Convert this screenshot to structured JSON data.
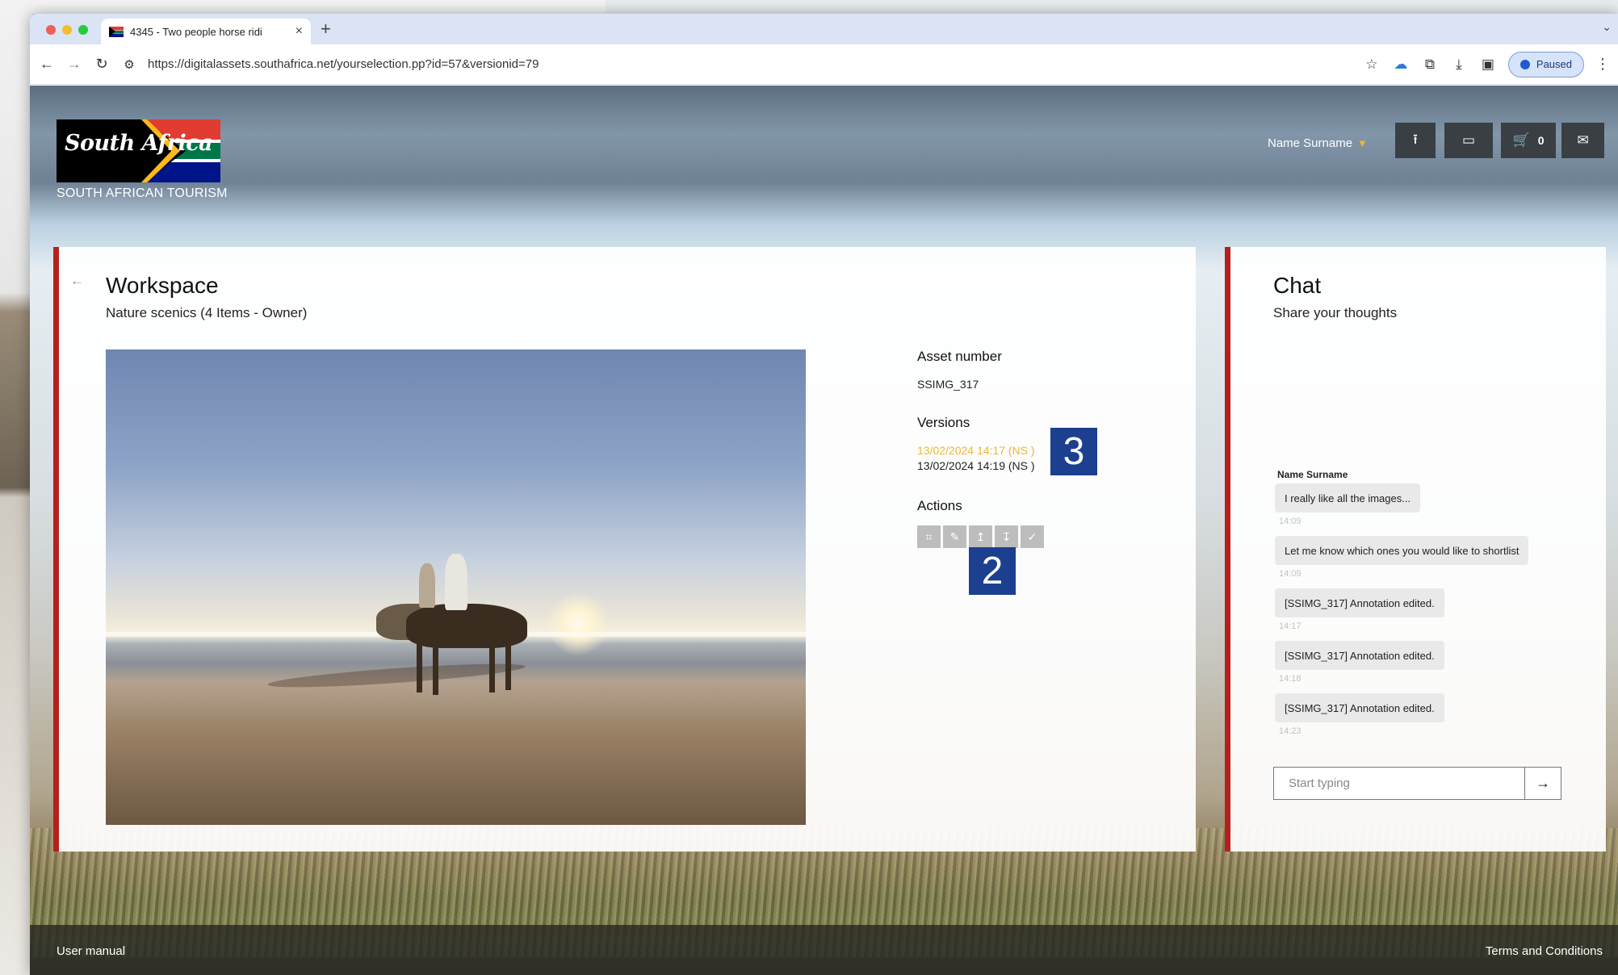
{
  "browser": {
    "tab_title": "4345 - Two people horse ridi",
    "tab_close": "×",
    "new_tab": "+",
    "url": "https://digitalassets.southafrica.net/yourselection.pp?id=57&versionid=79",
    "profile_label": "Paused",
    "icons": [
      "back-icon",
      "forward-icon",
      "reload-icon",
      "site-info-icon",
      "star-icon",
      "download-cloud-icon",
      "extensions-icon",
      "download-icon",
      "sidepanel-icon",
      "profile-icon",
      "menu-icon"
    ]
  },
  "header": {
    "logo_text": "South Africa",
    "brand_name": "SOUTH AFRICAN TOURISM",
    "user_name": "Name Surname",
    "cart_count": "0",
    "icons": [
      "upload-icon",
      "screen-icon",
      "cart-icon",
      "mail-icon"
    ]
  },
  "workspace": {
    "title": "Workspace",
    "subtitle": "Nature scenics (4 Items - Owner)",
    "asset_number_label": "Asset number",
    "asset_number": "SSIMG_317",
    "versions_label": "Versions",
    "versions": [
      {
        "text": "13/02/2024 14:17 (NS )",
        "active": true
      },
      {
        "text": "13/02/2024 14:19 (NS )",
        "active": false
      }
    ],
    "actions_label": "Actions",
    "action_icons": [
      "crop-icon",
      "edit-icon",
      "upload-icon",
      "download-icon",
      "check-icon"
    ],
    "badge_versions": "3",
    "badge_actions": "2",
    "accent_color": "#b6201c",
    "active_version_color": "#f0b62d"
  },
  "chat": {
    "title": "Chat",
    "subtitle": "Share your thoughts",
    "author": "Name Surname",
    "messages": [
      {
        "text": "I really like all the images...",
        "time": "14:09"
      },
      {
        "text": "Let me know which ones you would like to shortlist",
        "time": "14:09"
      },
      {
        "text": "[SSIMG_317] Annotation edited.",
        "time": "14:17"
      },
      {
        "text": "[SSIMG_317] Annotation edited.",
        "time": "14:18"
      },
      {
        "text": "[SSIMG_317] Annotation edited.",
        "time": "14:23"
      }
    ],
    "input_placeholder": "Start typing"
  },
  "footer": {
    "left_link": "User manual",
    "right_link": "Terms and Conditions"
  }
}
